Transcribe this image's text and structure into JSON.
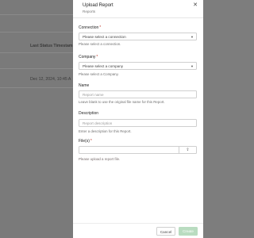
{
  "background": {
    "column_header": "Last Status Timestam",
    "timestamp": "Dec 12, 2024, 10:45 A"
  },
  "drawer": {
    "title": "Upload Report",
    "subtitle": "Reports",
    "close_icon": "close-icon",
    "connection": {
      "label": "Connection",
      "required": "*",
      "value": "Please select a connection",
      "help": "Please select a connection."
    },
    "company": {
      "label": "Company",
      "required": "*",
      "value": "Please select a company",
      "help": "Please select a Company."
    },
    "name": {
      "label": "Name",
      "placeholder": "Report name",
      "help": "Leave blank to use the original file name for this Report."
    },
    "description": {
      "label": "Description",
      "placeholder": "Report description",
      "help": "Enter a description for this Report."
    },
    "files": {
      "label": "File(s)",
      "required": "*",
      "upload_icon": "upload-icon",
      "help": "Please upload a report file."
    },
    "buttons": {
      "cancel": "Cancel",
      "create": "Create"
    }
  }
}
